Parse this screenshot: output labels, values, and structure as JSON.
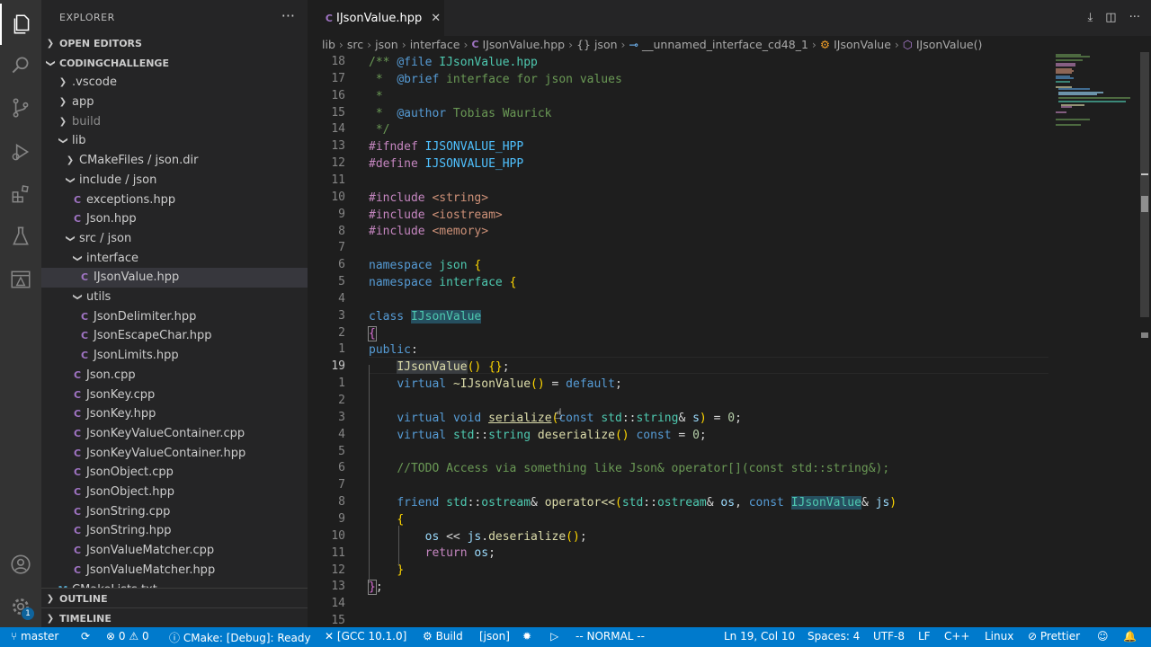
{
  "explorer": {
    "title": "EXPLORER",
    "sections": {
      "open_editors": "OPEN EDITORS",
      "workspace": "CODINGCHALLENGE",
      "outline": "OUTLINE",
      "timeline": "TIMELINE"
    },
    "tree": [
      {
        "label": ".vscode",
        "type": "folder"
      },
      {
        "label": "app",
        "type": "folder"
      },
      {
        "label": "build",
        "type": "folder"
      },
      {
        "label": "lib",
        "type": "folder-open"
      },
      {
        "label": "CMakeFiles / json.dir",
        "type": "folder"
      },
      {
        "label": "include / json",
        "type": "folder-open"
      },
      {
        "label": "exceptions.hpp",
        "type": "cpp"
      },
      {
        "label": "Json.hpp",
        "type": "cpp"
      },
      {
        "label": "src / json",
        "type": "folder-open"
      },
      {
        "label": "interface",
        "type": "folder-open"
      },
      {
        "label": "IJsonValue.hpp",
        "type": "cpp"
      },
      {
        "label": "utils",
        "type": "folder-open"
      },
      {
        "label": "JsonDelimiter.hpp",
        "type": "cpp"
      },
      {
        "label": "JsonEscapeChar.hpp",
        "type": "cpp"
      },
      {
        "label": "JsonLimits.hpp",
        "type": "cpp"
      },
      {
        "label": "Json.cpp",
        "type": "cpp"
      },
      {
        "label": "JsonKey.cpp",
        "type": "cpp"
      },
      {
        "label": "JsonKey.hpp",
        "type": "cpp"
      },
      {
        "label": "JsonKeyValueContainer.cpp",
        "type": "cpp"
      },
      {
        "label": "JsonKeyValueContainer.hpp",
        "type": "cpp"
      },
      {
        "label": "JsonObject.cpp",
        "type": "cpp"
      },
      {
        "label": "JsonObject.hpp",
        "type": "cpp"
      },
      {
        "label": "JsonString.cpp",
        "type": "cpp"
      },
      {
        "label": "JsonString.hpp",
        "type": "cpp"
      },
      {
        "label": "JsonValueMatcher.cpp",
        "type": "cpp"
      },
      {
        "label": "JsonValueMatcher.hpp",
        "type": "cpp"
      },
      {
        "label": "CMakeLists.txt",
        "type": "cmake"
      }
    ]
  },
  "tab": {
    "label": "IJsonValue.hpp",
    "icon": "cpp-icon"
  },
  "breadcrumb": [
    "lib",
    "src",
    "json",
    "interface",
    "IJsonValue.hpp",
    "{} json",
    "__unnamed_interface_cd48_1",
    "IJsonValue",
    "IJsonValue()"
  ],
  "editor": {
    "line_numbers": [
      "18",
      "17",
      "16",
      "15",
      "14",
      "13",
      "12",
      "11",
      "10",
      "9",
      "8",
      "7",
      "6",
      "5",
      "4",
      "3",
      "2",
      "1",
      "19",
      "1",
      "2",
      "3",
      "4",
      "5",
      "6",
      "7",
      "8",
      "9",
      "10",
      "11",
      "12",
      "13",
      "14",
      "15"
    ],
    "current_line_index": 18
  },
  "status": {
    "branch": "master",
    "sync": "",
    "problems": "0",
    "warnings": "0",
    "cmake": "CMake: [Debug]: Ready",
    "kit": "[GCC 10.1.0]",
    "build": "Build",
    "target": "[json]",
    "mode": "-- NORMAL --",
    "position": "Ln 19, Col 10",
    "spaces": "Spaces: 4",
    "encoding": "UTF-8",
    "eol": "LF",
    "language": "C++",
    "os": "Linux",
    "formatter": "Prettier"
  },
  "colors": {
    "statusbar": "#007acc",
    "activity": "#333333",
    "sidebar": "#252526",
    "editor": "#1e1e1e"
  }
}
